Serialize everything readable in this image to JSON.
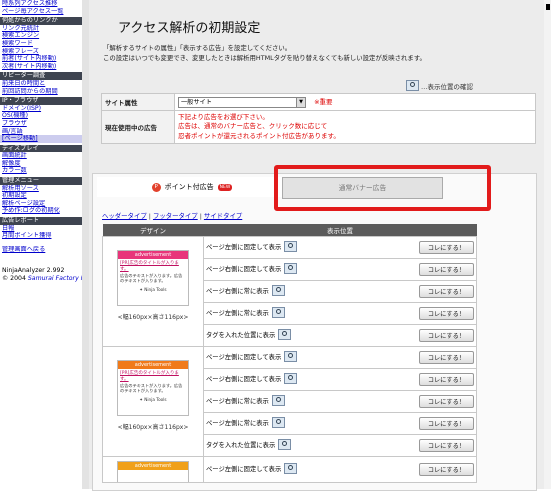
{
  "sidebar": {
    "top_links": [
      "時系列アクセス推移",
      "ページ毎アクセス一覧"
    ],
    "sections": [
      {
        "title": "何処からのリンクか",
        "items": [
          "リンク元統計",
          "検索エンジン",
          "検索ワード",
          "検索フレーズ",
          "前者(サイト内移動)",
          "次者(サイト内移動)"
        ]
      },
      {
        "title": "リピーター調査",
        "items": [
          "前来日の時間と",
          "前回訪問からの期間"
        ]
      },
      {
        "title": "IP・ブラウザ",
        "items": [
          "ドメイン(ISP)",
          "OS(機種)",
          "ブラウザ",
          "画/言語",
          "[ページ移動]"
        ]
      },
      {
        "title": "ディスプレイ",
        "items": [
          "画面統計",
          "解像度",
          "カラー数"
        ]
      },
      {
        "title": "管理メニュー",
        "items": [
          "解析用ソース",
          "初期設定",
          "解析ページ設定",
          "予め作:ログの初期化"
        ]
      },
      {
        "title": "広告レポート",
        "items": [
          "日報",
          "月間ポイント獲得"
        ]
      }
    ],
    "bottom_link": "管理画面へ戻る",
    "footer_version": "NinjaAnalyzer 2.992",
    "footer_copy": "© 2004",
    "footer_company": "Samurai Factory Inc"
  },
  "page": {
    "title": "アクセス解析の初期設定",
    "desc_line1": "「解析するサイトの属性」「表示する広告」を設定してください。",
    "desc_line2": "この設定はいつでも変更でき、変更したときは解析用HTMLタグを貼り替えなくても新しい設定が反映されます。",
    "help_label": "…表示位置の確認"
  },
  "settings": {
    "site_attr_label": "サイト属性",
    "site_attr_value": "一般サイト",
    "required": "※重要",
    "current_ad_label": "現在使用中の広告",
    "current_ad_lines": [
      "下記より広告をお選び下さい。",
      "広告は、通常のバナー広告と、クリック数に応じて",
      "忍者ポイントが還元されるポイント付広告があります。"
    ]
  },
  "tabs": {
    "points_label": "ポイント付広告",
    "new_badge": "NEW",
    "p_icon": "P",
    "normal_label": "通常バナー広告"
  },
  "sublinks": {
    "header": "ヘッダータイプ",
    "footer": "フッタータイプ",
    "side": "サイドタイプ"
  },
  "grid": {
    "headers": [
      "デザイン",
      "表示位置"
    ],
    "rows": [
      {
        "pos": "ページ左側に固定して表示",
        "btn": "コレにする！"
      },
      {
        "pos": "ページ右側に固定して表示",
        "btn": "コレにする！"
      },
      {
        "pos": "ページ右側に常に表示",
        "btn": "コレにする！"
      },
      {
        "pos": "ページ左側に常に表示",
        "btn": "コレにする！"
      },
      {
        "pos": "タグを入れた位置に表示",
        "btn": "コレにする！"
      },
      {
        "pos": "ページ左側に固定して表示",
        "btn": "コレにする！"
      },
      {
        "pos": "ページ右側に固定して表示",
        "btn": "コレにする！"
      },
      {
        "pos": "ページ右側に常に表示",
        "btn": "コレにする！"
      },
      {
        "pos": "ページ左側に常に表示",
        "btn": "コレにする！"
      },
      {
        "pos": "タグを入れた位置に表示",
        "btn": "コレにする！"
      },
      {
        "pos": "ページ左側に固定して表示",
        "btn": "コレにする！"
      }
    ],
    "ads": [
      {
        "head": "advertisement",
        "title": "[PR]広告のタイトルが入ります。",
        "text": "広告のテキストが入ります。広告のテキストが入ります。",
        "brand": "Ninja Tools",
        "caption": "<幅160px×高さ116px>",
        "color": "#e8357a"
      },
      {
        "head": "advertisement",
        "title": "[PR]広告のタイトルが入ります。",
        "text": "広告のテキストが入ります。広告のテキストが入ります。",
        "brand": "Ninja Tools",
        "caption": "<幅160px×高さ116px>",
        "color": "#f07a1a"
      },
      {
        "head": "advertisement",
        "color": "#f0a01a"
      }
    ]
  },
  "colors": {
    "highlight": "#e21b1b",
    "nav_link": "#0000cc",
    "section_bg": "#3e4450"
  }
}
